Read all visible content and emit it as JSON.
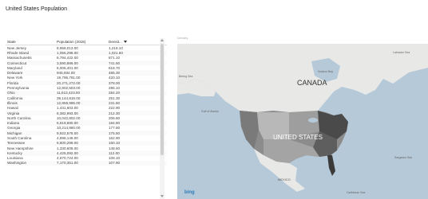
{
  "page": {
    "title": "United States Population"
  },
  "table": {
    "headers": {
      "state": "State",
      "population": "Population (2015)",
      "density": "Densit..."
    },
    "rows": [
      {
        "state": "New Jersey",
        "population": "8,958,013.00",
        "density": "1,218.10"
      },
      {
        "state": "Rhode Island",
        "population": "1,056,298.00",
        "density": "1,021.60"
      },
      {
        "state": "Massachusetts",
        "population": "6,794,422.00",
        "density": "871.10"
      },
      {
        "state": "Connecticut",
        "population": "3,590,886.00",
        "density": "741.60"
      },
      {
        "state": "Maryland",
        "population": "6,006,401.00",
        "density": "618.70"
      },
      {
        "state": "Delaware",
        "population": "945,934.00",
        "density": "485.30"
      },
      {
        "state": "New York",
        "population": "19,795,791.00",
        "density": "420.10"
      },
      {
        "state": "Florida",
        "population": "20,271,272.00",
        "density": "378.00"
      },
      {
        "state": "Pennsylvania",
        "population": "12,802,503.00",
        "density": "286.10"
      },
      {
        "state": "Ohio",
        "population": "11,613,423.00",
        "density": "284.20"
      },
      {
        "state": "California",
        "population": "39,144,818.00",
        "density": "251.30"
      },
      {
        "state": "Illinois",
        "population": "12,859,995.00",
        "density": "231.60"
      },
      {
        "state": "Hawaii",
        "population": "1,431,603.00",
        "density": "222.90"
      },
      {
        "state": "Virginia",
        "population": "8,382,993.00",
        "density": "212.30"
      },
      {
        "state": "North Carolina",
        "population": "10,042,802.00",
        "density": "206.60"
      },
      {
        "state": "Indiana",
        "population": "6,619,680.00",
        "density": "184.80"
      },
      {
        "state": "Georgia",
        "population": "10,214,860.00",
        "density": "177.60"
      },
      {
        "state": "Michigan",
        "population": "9,922,576.00",
        "density": "175.50"
      },
      {
        "state": "South Carolina",
        "population": "4,896,146.00",
        "density": "162.90"
      },
      {
        "state": "Tennessee",
        "population": "6,600,299.00",
        "density": "160.10"
      },
      {
        "state": "New Hampshire",
        "population": "1,330,608.00",
        "density": "148.60"
      },
      {
        "state": "Kentucky",
        "population": "4,425,092.00",
        "density": "112.00"
      },
      {
        "state": "Louisiana",
        "population": "4,670,724.00",
        "density": "108.10"
      },
      {
        "state": "Washington",
        "population": "7,170,351.00",
        "density": "107.90"
      }
    ]
  },
  "map": {
    "visual_label": "Density",
    "labels": {
      "canada": "CANADA",
      "united_states": "UNITED STATES",
      "mexico": "MEXICO",
      "bering_sea": "Bering Sea",
      "gulf_of_alaska": "Gulf of Alaska",
      "hudson_bay": "Hudson Bay",
      "labrador_sea": "Labrador Sea",
      "sargasso_sea": "Sargasso Sea",
      "caribbean_sea": "Caribbean Sea"
    },
    "attribution": "bing",
    "colors": {
      "water": "#b6c9d8",
      "land": "#e8e8e6",
      "choropleth_dark": "#3a3a3a",
      "choropleth_light": "#cfcfcf"
    }
  }
}
